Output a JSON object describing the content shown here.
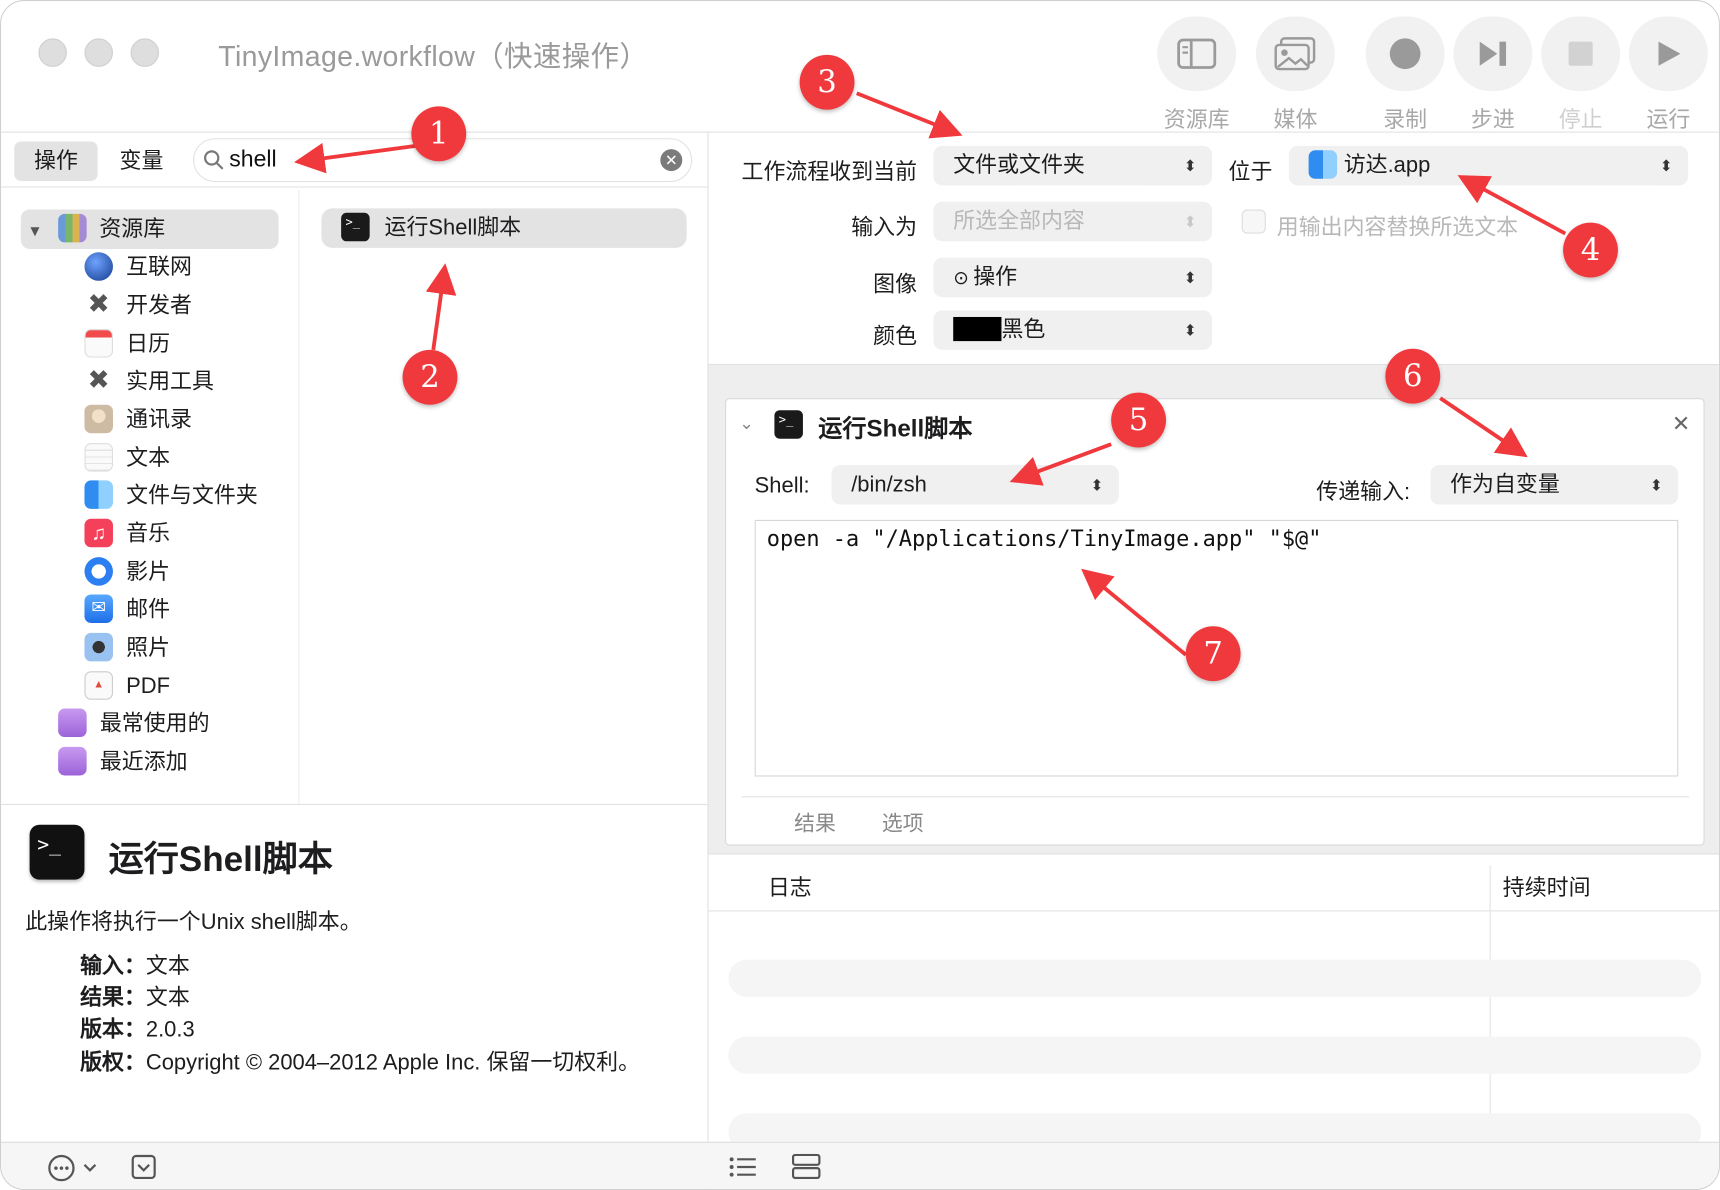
{
  "window": {
    "title": "TinyImage.workflow（快速操作）"
  },
  "toolbar": {
    "library": "资源库",
    "media": "媒体",
    "record": "录制",
    "step": "步进",
    "stop": "停止",
    "run": "运行"
  },
  "left": {
    "tab_actions": "操作",
    "tab_variables": "变量",
    "search_value": "shell",
    "library_root": "资源库",
    "categories": [
      "互联网",
      "开发者",
      "日历",
      "实用工具",
      "通讯录",
      "文本",
      "文件与文件夹",
      "音乐",
      "影片",
      "邮件",
      "照片",
      "PDF"
    ],
    "most_used": "最常使用的",
    "recently_added": "最近添加",
    "result": "运行Shell脚本"
  },
  "description": {
    "title": "运行Shell脚本",
    "summary": "此操作将执行一个Unix shell脚本。",
    "input_label": "输入：",
    "input_value": "文本",
    "result_label": "结果：",
    "result_value": "文本",
    "version_label": "版本：",
    "version_value": "2.0.3",
    "copyright_label": "版权：",
    "copyright_value": "Copyright © 2004–2012 Apple Inc. 保留一切权利。"
  },
  "workflow_params": {
    "receives_label": "工作流程收到当前",
    "receives_value": "文件或文件夹",
    "in_label": "位于",
    "in_value": "访达.app",
    "input_is_label": "输入为",
    "input_is_value": "所选全部内容",
    "replace_label": "用输出内容替换所选文本",
    "image_label": "图像",
    "image_value": "操作",
    "color_label": "颜色",
    "color_value": "黑色"
  },
  "action_card": {
    "title": "运行Shell脚本",
    "shell_label": "Shell:",
    "shell_value": "/bin/zsh",
    "pass_input_label": "传递输入:",
    "pass_input_value": "作为自变量",
    "script": "open -a \"/Applications/TinyImage.app\" \"$@\"",
    "tab_results": "结果",
    "tab_options": "选项"
  },
  "log": {
    "col_log": "日志",
    "col_duration": "持续时间"
  },
  "annotations": [
    "1",
    "2",
    "3",
    "4",
    "5",
    "6",
    "7"
  ],
  "colors": {
    "badge": "#f0393d",
    "selection": "#e3e3e3",
    "flow_bg": "#eeeeee"
  }
}
